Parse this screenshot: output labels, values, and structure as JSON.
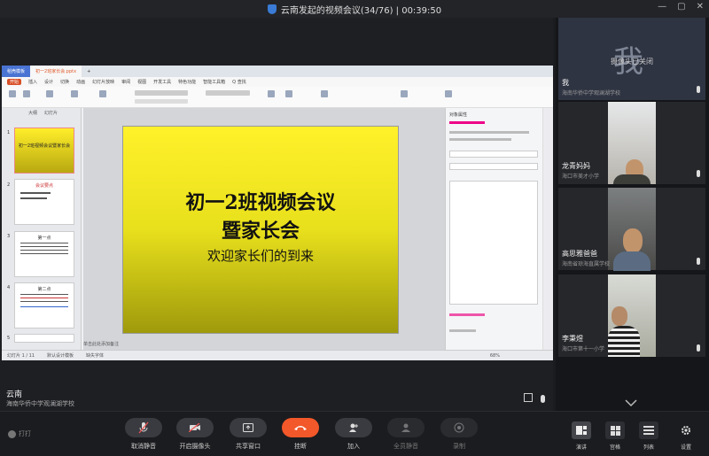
{
  "window": {
    "title": "云南发起的视频会议(34/76) | 00:39:50"
  },
  "wps": {
    "tab_home": "稻壳模板",
    "tab_file": "初一2班家长会.pptx",
    "menu_items": [
      "开始",
      "插入",
      "设计",
      "切换",
      "动画",
      "幻灯片放映",
      "审阅",
      "视图",
      "开发工具",
      "特色功能",
      "智能工具箱",
      "Q 查找"
    ],
    "thumb_tabs": [
      "大纲",
      "幻灯片"
    ],
    "add_note": "单击此处添加备注",
    "status_left": "幻灯片 1 / 11",
    "status_mid": "默认设计模板",
    "status_missing": "缺失字体",
    "zoom": "68%",
    "panel_title": "对象属性",
    "slide_numbers": [
      "1",
      "2",
      "3",
      "4",
      "5"
    ],
    "slide_titles": [
      "初一2班视频会议暨家长会",
      "会议要点",
      "第一点",
      "第二点"
    ]
  },
  "slide": {
    "line1": "初一2班视频会议",
    "line2": "暨家长会",
    "line3": "欢迎家长们的到来"
  },
  "speaker": {
    "name": "云南",
    "org": "海南华侨中学观澜湖学校"
  },
  "participants": [
    {
      "name": "我",
      "org": "海南华侨中学观澜湖学校",
      "char": "我",
      "status": "摄像头已关闭"
    },
    {
      "name": "龙青妈妈",
      "org": "海口市美才小学"
    },
    {
      "name": "高思雅爸爸",
      "org": "海南省琼海直属学校"
    },
    {
      "name": "李秉煜",
      "org": "海口市第十一小学"
    }
  ],
  "toolbar": {
    "logo": "打打",
    "buttons": [
      "取消静音",
      "开启摄像头",
      "共享窗口",
      "挂断",
      "加入",
      "全员静音",
      "录制"
    ],
    "views": [
      "演讲",
      "宫格",
      "列表"
    ],
    "settings": "设置"
  },
  "colors": {
    "hangup": "#f2582a",
    "slide_yellow": "#fff12a",
    "accent_orange": "#d94f27"
  }
}
